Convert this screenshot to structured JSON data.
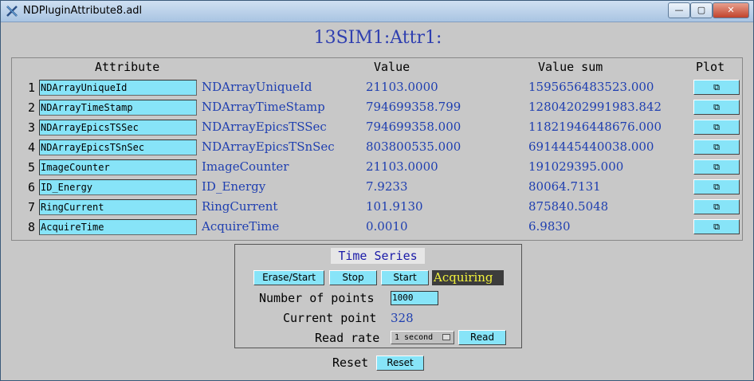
{
  "window": {
    "title": "NDPluginAttribute8.adl",
    "min": "—",
    "max": "▢",
    "close": "✕"
  },
  "header": {
    "title": "13SIM1:Attr1:"
  },
  "table": {
    "columns": {
      "attribute": "Attribute",
      "value": "Value",
      "value_sum": "Value sum",
      "plot": "Plot"
    },
    "plot_icon": "⧉",
    "rows": [
      {
        "num": "1",
        "attr": "NDArrayUniqueId",
        "name": "NDArrayUniqueId",
        "value": "21103.0000",
        "sum": "1595656483523.000"
      },
      {
        "num": "2",
        "attr": "NDArrayTimeStamp",
        "name": "NDArrayTimeStamp",
        "value": "794699358.799",
        "sum": "12804202991983.842"
      },
      {
        "num": "3",
        "attr": "NDArrayEpicsTSSec",
        "name": "NDArrayEpicsTSSec",
        "value": "794699358.000",
        "sum": "11821946448676.000"
      },
      {
        "num": "4",
        "attr": "NDArrayEpicsTSnSec",
        "name": "NDArrayEpicsTSnSec",
        "value": "803800535.000",
        "sum": "6914445440038.000"
      },
      {
        "num": "5",
        "attr": "ImageCounter",
        "name": "ImageCounter",
        "value": "21103.0000",
        "sum": "191029395.000"
      },
      {
        "num": "6",
        "attr": "ID_Energy",
        "name": "ID_Energy",
        "value": "7.9233",
        "sum": "80064.7131"
      },
      {
        "num": "7",
        "attr": "RingCurrent",
        "name": "RingCurrent",
        "value": "101.9130",
        "sum": "875840.5048"
      },
      {
        "num": "8",
        "attr": "AcquireTime",
        "name": "AcquireTime",
        "value": "0.0010",
        "sum": "6.9830"
      }
    ]
  },
  "time_series": {
    "title": "Time Series",
    "erase_start": "Erase/Start",
    "stop": "Stop",
    "start": "Start",
    "status": "Acquiring",
    "num_points_label": "Number of points",
    "num_points_value": "1000",
    "current_point_label": "Current point",
    "current_point_value": "328",
    "read_rate_label": "Read rate",
    "read_rate_value": "1 second",
    "read_button": "Read"
  },
  "footer": {
    "reset_label": "Reset",
    "reset_button": "Reset"
  },
  "colors": {
    "cyan": "#87e4f8",
    "blue_text": "#1f3fb0",
    "panel_bg": "#c8c8c8",
    "status_bg": "#3c3c3c",
    "status_text": "#f2f23c"
  }
}
